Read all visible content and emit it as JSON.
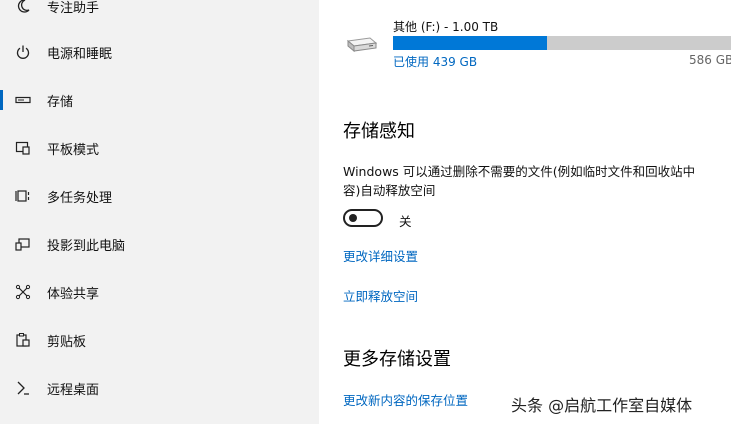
{
  "sidebar": {
    "items": [
      {
        "label": "专注助手",
        "icon": "moon-icon"
      },
      {
        "label": "电源和睡眠",
        "icon": "power-icon"
      },
      {
        "label": "存储",
        "icon": "storage-icon",
        "selected": true
      },
      {
        "label": "平板模式",
        "icon": "tablet-mode-icon"
      },
      {
        "label": "多任务处理",
        "icon": "multitasking-icon"
      },
      {
        "label": "投影到此电脑",
        "icon": "project-icon"
      },
      {
        "label": "体验共享",
        "icon": "shared-experiences-icon"
      },
      {
        "label": "剪贴板",
        "icon": "clipboard-icon"
      },
      {
        "label": "远程桌面",
        "icon": "remote-desktop-icon"
      }
    ],
    "accent_color": "#0067c0"
  },
  "drive": {
    "name": "其他 (F:) - 1.00 TB",
    "used_label": "已使用 439 GB",
    "free_label": "586 GB",
    "used_fraction": 0.45,
    "bar_color": "#0078d7",
    "track_color": "#cccccc"
  },
  "storage_sense": {
    "title": "存储感知",
    "description_line1": "Windows 可以通过删除不需要的文件(例如临时文件和回收站中",
    "description_line2": "容)自动释放空间",
    "toggle_label": "关",
    "toggle_on": false,
    "links": [
      "更改详细设置",
      "立即释放空间"
    ]
  },
  "more_storage": {
    "title": "更多存储设置",
    "links": [
      "更改新内容的保存位置"
    ]
  },
  "watermark": "头条 @启航工作室自媒体"
}
